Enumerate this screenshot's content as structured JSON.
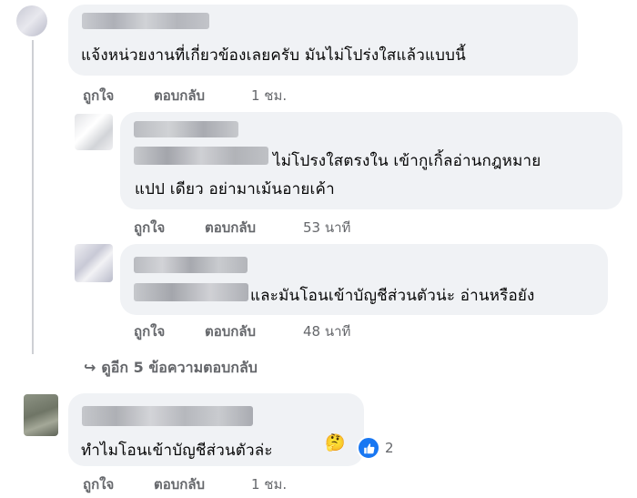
{
  "comments": [
    {
      "text_lines": [
        "แจ้งหน่วยงานที่เกี่ยวข้องเลยครับ มันไม่โปร่งใสแล้วแบบนี้"
      ],
      "like_label": "ถูกใจ",
      "reply_label": "ตอบกลับ",
      "time": "1 ชม."
    },
    {
      "text_lines": [
        "ไม่โปรงใสตรงใน เข้ากูเกิ้ลอ่านกฎหมาย",
        "แปป เดียว อย่ามาเม้นอายเค้า"
      ],
      "like_label": "ถูกใจ",
      "reply_label": "ตอบกลับ",
      "time": "53 นาที"
    },
    {
      "text_lines": [
        "และมันโอนเข้าบัญชีส่วนตัวน่ะ อ่านหรือยัง"
      ],
      "like_label": "ถูกใจ",
      "reply_label": "ตอบกลับ",
      "time": "48 นาที"
    },
    {
      "text_lines": [
        "ทำไมโอนเข้าบัญชีส่วนตัวล่ะ"
      ],
      "like_label": "ถูกใจ",
      "reply_label": "ตอบกลับ",
      "time": "1 ชม.",
      "reaction": {
        "icon": "like-icon",
        "count": "2",
        "emoji": "🤔"
      }
    }
  ],
  "view_more_replies": "ดูอีก 5 ข้อความตอบกลับ",
  "colors": {
    "bubble": "#f0f2f5",
    "meta": "#65676b",
    "like_blue": "#1877f2"
  }
}
